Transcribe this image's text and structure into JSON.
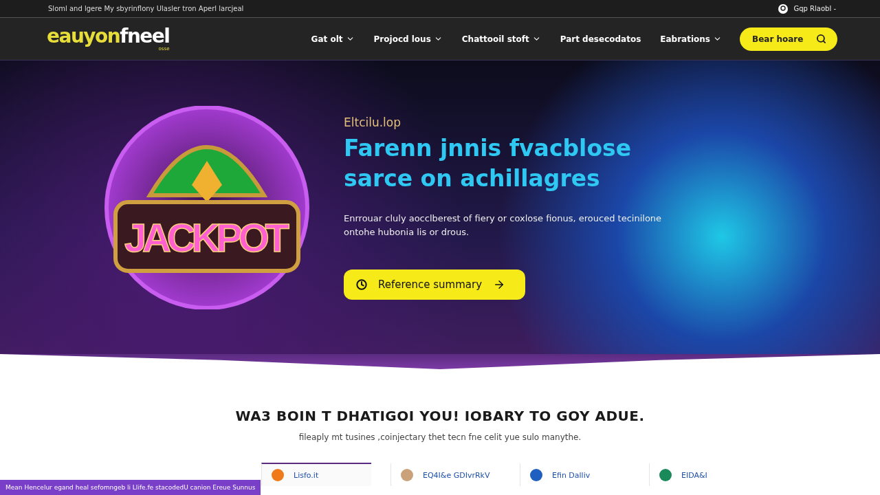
{
  "top_bar": {
    "notice": "Sloml and lgere My sbyrinflony  Ulasler tron Aperl larcjeal",
    "account": "Gqp Rlaobl -"
  },
  "logo": {
    "primary": "eauyon",
    "secondary": "fneel",
    "tagline": "osse"
  },
  "nav": {
    "items": [
      {
        "label": "Gat olt",
        "dropdown": true
      },
      {
        "label": "Projocd lous",
        "dropdown": true
      },
      {
        "label": "Chattooil stoft",
        "dropdown": true
      },
      {
        "label": "Part desecodatos",
        "dropdown": false
      },
      {
        "label": "Eabrations",
        "dropdown": true
      }
    ],
    "search_button": "Bear hoare"
  },
  "hero": {
    "emblem_text": "JACKPOT",
    "eyebrow": "Eltcilu.lop",
    "title_lines": [
      "Farenn jnnis fvacblose",
      "sarce on achillagres"
    ],
    "body": "Enrrouar cluly aocclberest of fiery or coxlose fionus, erouced tecinilone ontohe hubonia lis or drous.",
    "cta": "Reference summary"
  },
  "section": {
    "heading": "WA3 BOIN T DHATIGOI YOU! IOBARY TO GOY ADUE.",
    "subtitle": "fileaply mt tusines ,coinjectary thet tecn fne celit yue sulo manythe."
  },
  "cards": [
    {
      "title": "Lisfo.it",
      "selected": true,
      "color": "#f07a1a"
    },
    {
      "title": "EQ4I&e GDIvrRkV",
      "selected": false,
      "color": "#c9a27a"
    },
    {
      "title": "Efin Dalliv",
      "selected": false,
      "color": "#1f5fbf"
    },
    {
      "title": "EIDA&I",
      "selected": false,
      "color": "#1b8a5a"
    }
  ],
  "notice_banner": "Mean Hencelur egand heal sefomngeb li Llife.fe stacodedU canion Ereue Sunnus"
}
